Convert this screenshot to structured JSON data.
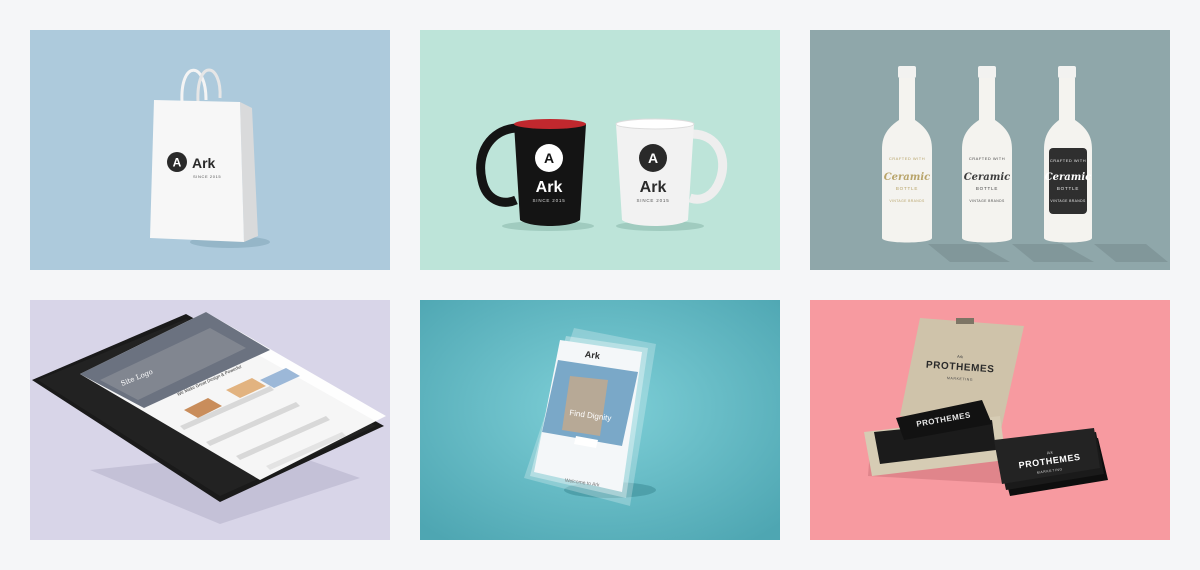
{
  "portfolio": {
    "tiles": [
      {
        "name": "shopping-bag-mockup",
        "bg": "#adcadc",
        "logo_letter": "A",
        "brand": "Ark",
        "tagline": "SINCE 2015"
      },
      {
        "name": "mugs-mockup",
        "bg": "#bde4d9",
        "logo_letter": "A",
        "brand": "Ark",
        "tagline": "SINCE 2015"
      },
      {
        "name": "bottles-mockup",
        "bg": "#8fa7aa",
        "label_top": "CRAFTED WITH",
        "label_main": "Ceramic",
        "label_sub": "BOTTLE",
        "label_bottom": "VINTAGE BRANDS"
      },
      {
        "name": "tablet-mockup",
        "bg": "#d8d5e8",
        "headline": "We Make Great Design & Powerful",
        "logo": "Site Logo"
      },
      {
        "name": "phone-mockup",
        "bg": "#5eb4c0",
        "logo": "Ark",
        "hero_text": "Find Dignity",
        "footer_text": "Welcome to Ark"
      },
      {
        "name": "business-cards-mockup",
        "bg": "#f79aa0",
        "small_text": "Ark",
        "brand": "PROTHEMES",
        "tagline": "MARKETING"
      }
    ]
  }
}
